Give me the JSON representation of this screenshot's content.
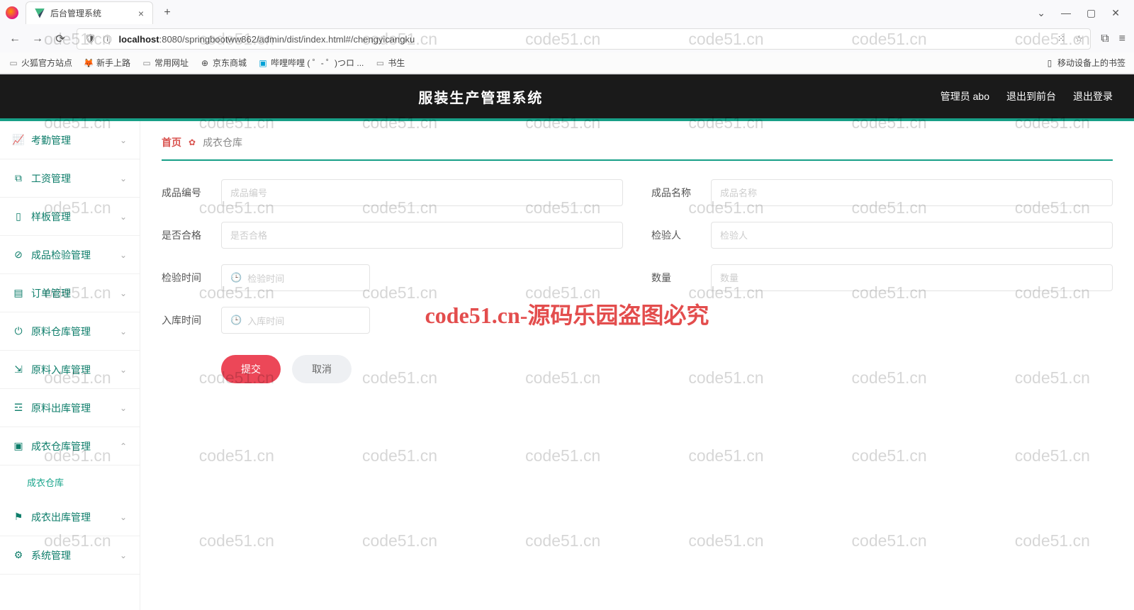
{
  "browser": {
    "tab_title": "后台管理系统",
    "url_host": "localhost",
    "url_path": ":8080/springbootww862/admin/dist/index.html#/chengyicangku",
    "bookmarks": [
      "火狐官方站点",
      "新手上路",
      "常用网址",
      "京东商城",
      "哔哩哔哩 (  ゜- ゜)つロ ...",
      "书生"
    ],
    "bookmark_right": "移动设备上的书签"
  },
  "header": {
    "title": "服装生产管理系统",
    "user": "管理员 abo",
    "to_front": "退出到前台",
    "logout": "退出登录"
  },
  "sidebar": {
    "items": [
      {
        "label": "考勤管理",
        "icon": "chart"
      },
      {
        "label": "工资管理",
        "icon": "copy"
      },
      {
        "label": "样板管理",
        "icon": "phone"
      },
      {
        "label": "成品检验管理",
        "icon": "check"
      },
      {
        "label": "订单管理",
        "icon": "list"
      },
      {
        "label": "原料仓库管理",
        "icon": "power"
      },
      {
        "label": "原料入库管理",
        "icon": "in"
      },
      {
        "label": "原料出库管理",
        "icon": "adjust"
      },
      {
        "label": "成衣仓库管理",
        "icon": "box",
        "expanded": true,
        "sub": "成衣仓库"
      },
      {
        "label": "成衣出库管理",
        "icon": "flag"
      },
      {
        "label": "系统管理",
        "icon": "gear"
      }
    ]
  },
  "breadcrumb": {
    "home": "首页",
    "current": "成衣仓库"
  },
  "form": {
    "product_no": {
      "label": "成品编号",
      "placeholder": "成品编号"
    },
    "product_name": {
      "label": "成品名称",
      "placeholder": "成品名称"
    },
    "qualified": {
      "label": "是否合格",
      "placeholder": "是否合格"
    },
    "inspector": {
      "label": "检验人",
      "placeholder": "检验人"
    },
    "inspect_time": {
      "label": "检验时间",
      "placeholder": "检验时间"
    },
    "quantity": {
      "label": "数量",
      "placeholder": "数量"
    },
    "in_time": {
      "label": "入库时间",
      "placeholder": "入库时间"
    },
    "submit": "提交",
    "cancel": "取消"
  },
  "watermark": {
    "text": "code51.cn",
    "big": "code51.cn-源码乐园盗图必究"
  }
}
